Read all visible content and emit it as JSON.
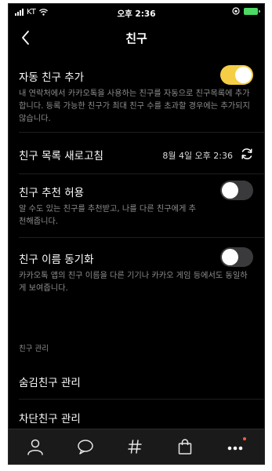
{
  "status_bar": {
    "carrier": "KT",
    "time": "오후 2:36"
  },
  "nav": {
    "title": "친구"
  },
  "settings": {
    "auto_add": {
      "title": "자동 친구 추가",
      "description": "내 연락처에서 카카오톡을 사용하는 친구를 자동으로 친구목록에 추가합니다. 등록 가능한 친구가 최대 친구 수를 초과할 경우에는 추가되지 않습니다.",
      "enabled": true
    },
    "refresh": {
      "title": "친구 목록 새로고침",
      "timestamp": "8월 4일 오후 2:36"
    },
    "recommend": {
      "title": "친구 추천 허용",
      "description": "알 수도 있는 친구를 추천받고, 나를 다른 친구에게 추천해줍니다.",
      "enabled": false
    },
    "name_sync": {
      "title": "친구 이름 동기화",
      "description": "카카오톡 앱의 친구 이름을 다른 기기나 카카오 게임 등에서도 동일하게 보여줍니다.",
      "enabled": false
    }
  },
  "management": {
    "section_label": "친구 관리",
    "items": [
      {
        "label": "숨김친구 관리"
      },
      {
        "label": "차단친구 관리"
      }
    ]
  },
  "colors": {
    "accent": "#f5ce46",
    "background": "#000000",
    "secondary_text": "#8c8c8c",
    "badge": "#ff5a3c"
  },
  "tabs": [
    {
      "icon": "person-icon"
    },
    {
      "icon": "chat-bubble-icon"
    },
    {
      "icon": "hashtag-icon"
    },
    {
      "icon": "shopping-bag-icon"
    },
    {
      "icon": "more-icon"
    }
  ]
}
